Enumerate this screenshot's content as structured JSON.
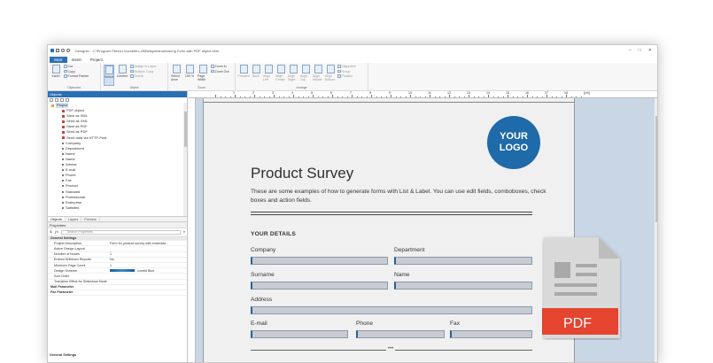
{
  "window": {
    "title": "Designer - C:\\Program Files\\LL\\combit\\LL25\\Beispielanwendung Form with PDF object.sfrm",
    "controls": [
      "–",
      "□",
      "✕"
    ]
  },
  "ribbon_tabs": [
    "Start",
    "Insert",
    "Project"
  ],
  "ribbon": {
    "clipboard": {
      "insert": "Insert",
      "cut": "Cut",
      "copy": "Copy",
      "format_painter": "Format Painter",
      "name": "Clipboard"
    },
    "object": {
      "select": "Select",
      "content": "Content",
      "assign_to_layer": "Assign to Layer",
      "multiple_copy": "Multiple Copy",
      "delete": "Delete",
      "name": "Object"
    },
    "zoom": {
      "select_area": "Select Area",
      "fit_pct": "100 %",
      "page_width": "Page Width",
      "zoom_in": "Zoom In",
      "zoom_out": "Zoom Out",
      "name": "Zoom"
    },
    "arrange": {
      "forward": "Forward",
      "back": "Back",
      "align_left": "Align Left",
      "align_center": "Align Center",
      "align_right": "Align Right",
      "align_top": "Align Top",
      "align_middle": "Align Middle",
      "align_bottom": "Align Bottom",
      "alignment": "Alignment",
      "group": "Group",
      "position": "Position",
      "name": "Arrange"
    }
  },
  "objects_pane": {
    "title": "Objects",
    "tree": [
      {
        "label": "Project",
        "kind": "root"
      },
      {
        "label": "PDF object",
        "kind": "item"
      },
      {
        "label": "Save as XML",
        "kind": "item"
      },
      {
        "label": "Send as XML",
        "kind": "item"
      },
      {
        "label": "Save as PDF",
        "kind": "item"
      },
      {
        "label": "Send as PDF",
        "kind": "item"
      },
      {
        "label": "Send data via HTTP-Post",
        "kind": "item"
      },
      {
        "label": "Company",
        "kind": "field"
      },
      {
        "label": "Department",
        "kind": "field"
      },
      {
        "label": "Name",
        "kind": "field"
      },
      {
        "label": "Name",
        "kind": "field"
      },
      {
        "label": "Adress",
        "kind": "field"
      },
      {
        "label": "E-mail",
        "kind": "field"
      },
      {
        "label": "Phone",
        "kind": "field"
      },
      {
        "label": "Fax",
        "kind": "field"
      },
      {
        "label": "Product",
        "kind": "field"
      },
      {
        "label": "Standard",
        "kind": "field"
      },
      {
        "label": "Professional",
        "kind": "field"
      },
      {
        "label": "Enterprise",
        "kind": "field"
      },
      {
        "label": "Satisfied",
        "kind": "field"
      }
    ],
    "subtabs": [
      "Objects",
      "Layers",
      "Preview"
    ]
  },
  "properties": {
    "title": "Properties",
    "search_placeholder": "Search Properties",
    "rows": [
      {
        "name": "General Settings",
        "value": "",
        "kind": "cat"
      },
      {
        "name": "Project Description",
        "value": "Form for product survey with embedde...",
        "kind": "row"
      },
      {
        "name": "Active Design Layout",
        "value": "",
        "kind": "row"
      },
      {
        "name": "Number of Issues",
        "value": "1",
        "kind": "row"
      },
      {
        "name": "Embed Drilldown Reports",
        "value": "No",
        "kind": "row"
      },
      {
        "name": "Minimum Page Count",
        "value": "1",
        "kind": "row"
      },
      {
        "name": "Design Scheme",
        "value": "combit Blue",
        "kind": "row"
      },
      {
        "name": "Sort Order",
        "value": "",
        "kind": "row"
      },
      {
        "name": "Transition Effect for Slideshow Mode",
        "value": "",
        "kind": "row"
      },
      {
        "name": "Mail Parameter",
        "value": "",
        "kind": "sub"
      },
      {
        "name": "Fax Parameter",
        "value": "",
        "kind": "sub"
      }
    ],
    "footer": "General Settings"
  },
  "ruler": {
    "labels": [
      "1",
      "2",
      "3",
      "4",
      "5",
      "6",
      "7",
      "8",
      "9",
      "10",
      "11",
      "12",
      "13",
      "14",
      "15",
      "16",
      "17",
      "18",
      "[cm]"
    ]
  },
  "document": {
    "logo_line1": "YOUR",
    "logo_line2": "LOGO",
    "heading": "Product Survey",
    "intro": "These are some examples of how to generate forms with List & Label. You can use edit fields, comboboxes, check boxes and action fields.",
    "section": "YOUR DETAILS",
    "fields": {
      "company": "Company",
      "department": "Department",
      "surname": "Surname",
      "name": "Name",
      "address": "Address",
      "email": "E-mail",
      "phone": "Phone",
      "fax": "Fax"
    },
    "dots": "•••"
  },
  "pdf_icon": {
    "label": "PDF",
    "color": "#e5442f"
  },
  "colors": {
    "accent": "#2a6fb4",
    "logo": "#1f6aa9",
    "canvas": "#c9d6e6"
  }
}
